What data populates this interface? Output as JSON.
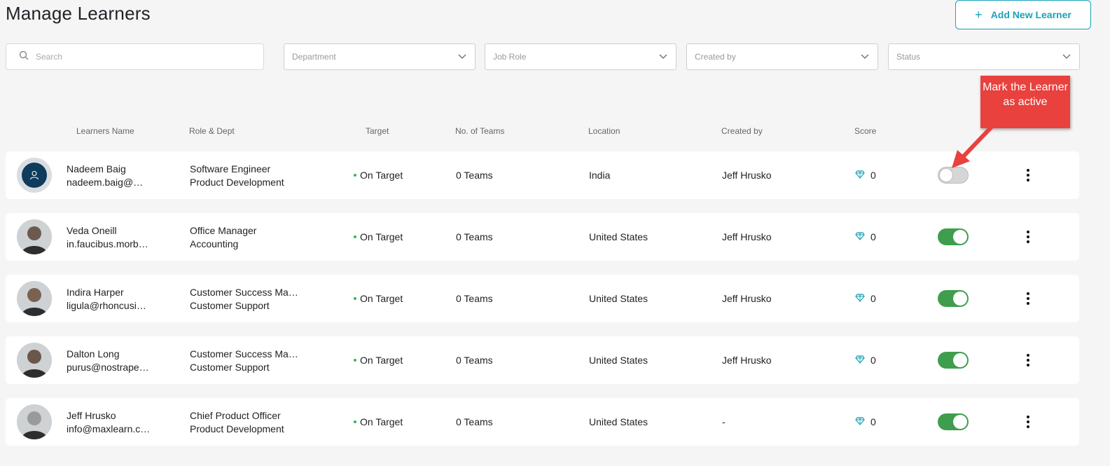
{
  "header": {
    "title": "Manage Learners",
    "add_button_label": "Add New Learner"
  },
  "filters": {
    "search_placeholder": "Search",
    "department_placeholder": "Department",
    "job_role_placeholder": "Job Role",
    "created_by_placeholder": "Created by",
    "status_placeholder": "Status"
  },
  "columns": {
    "name": "Learners Name",
    "role": "Role & Dept",
    "target": "Target",
    "teams": "No. of Teams",
    "location": "Location",
    "created_by": "Created by",
    "score": "Score"
  },
  "learners": [
    {
      "name": "Nadeem Baig",
      "email": "nadeem.baig@m…",
      "role": "Software Engineer",
      "dept": "Product Development",
      "target": "On Target",
      "teams": "0 Teams",
      "location": "India",
      "created_by": "Jeff Hrusko",
      "score": "0",
      "active": false,
      "avatar": "default-user-icon"
    },
    {
      "name": "Veda Oneill",
      "email": "in.faucibus.morb…",
      "role": "Office Manager",
      "dept": "Accounting",
      "target": "On Target",
      "teams": "0 Teams",
      "location": "United States",
      "created_by": "Jeff Hrusko",
      "score": "0",
      "active": true,
      "avatar": "photo"
    },
    {
      "name": "Indira Harper",
      "email": "ligula@rhoncusid…",
      "role": "Customer Success Man…",
      "dept": "Customer Support",
      "target": "On Target",
      "teams": "0 Teams",
      "location": "United States",
      "created_by": "Jeff Hrusko",
      "score": "0",
      "active": true,
      "avatar": "photo"
    },
    {
      "name": "Dalton Long",
      "email": "purus@nostraper…",
      "role": "Customer Success Man…",
      "dept": "Customer Support",
      "target": "On Target",
      "teams": "0 Teams",
      "location": "United States",
      "created_by": "Jeff Hrusko",
      "score": "0",
      "active": true,
      "avatar": "photo"
    },
    {
      "name": "Jeff Hrusko",
      "email": "info@maxlearn.c…",
      "role": "Chief Product Officer",
      "dept": "Product Development",
      "target": "On Target",
      "teams": "0 Teams",
      "location": "United States",
      "created_by": "-",
      "score": "0",
      "active": true,
      "avatar": "photo"
    }
  ],
  "callout": {
    "text": "Mark the Learner as active"
  },
  "colors": {
    "accent": "#1aa2b8",
    "toggle_on": "#3e9e4e",
    "callout": "#e8413e",
    "target_dot": "#2eb85c"
  }
}
